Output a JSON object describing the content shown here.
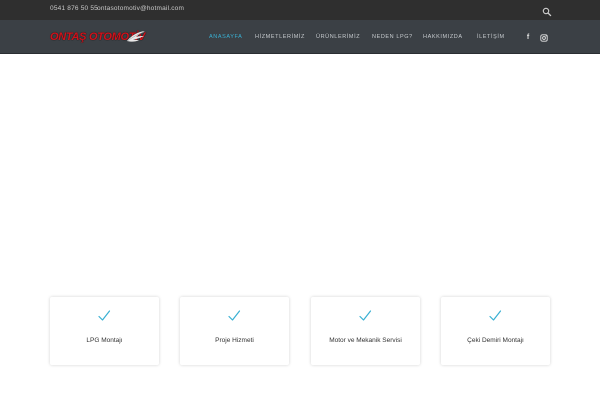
{
  "topbar": {
    "phone": "0541 876 50 55",
    "email": "ontasotomotiv@hotmail.com",
    "search_icon": "search-icon"
  },
  "brand": {
    "logo_text": "ONTAŞ OTOMOTİV",
    "logo_color": "#d0121b"
  },
  "nav": {
    "items": [
      {
        "label": "ANASAYFA",
        "active": true
      },
      {
        "label": "HİZMETLERİMİZ",
        "active": false
      },
      {
        "label": "ÜRÜNLERİMİZ",
        "active": false
      },
      {
        "label": "NEDEN LPG?",
        "active": false
      },
      {
        "label": "HAKKIMIZDA",
        "active": false
      },
      {
        "label": "İLETİŞİM",
        "active": false
      }
    ],
    "social": [
      {
        "name": "facebook-icon",
        "glyph": "f"
      },
      {
        "name": "instagram-icon",
        "glyph": ""
      }
    ],
    "active_color": "#39b0d3"
  },
  "services": [
    {
      "title": "LPG Montajı",
      "icon": "check-icon"
    },
    {
      "title": "Proje Hizmeti",
      "icon": "check-icon"
    },
    {
      "title": "Motor ve Mekanik Servisi",
      "icon": "check-icon"
    },
    {
      "title": "Çeki Demiri Montajı",
      "icon": "check-icon"
    }
  ],
  "colors": {
    "topbar_bg": "#2f2f2f",
    "navbar_bg": "#3b4045",
    "accent": "#39b0d3"
  }
}
